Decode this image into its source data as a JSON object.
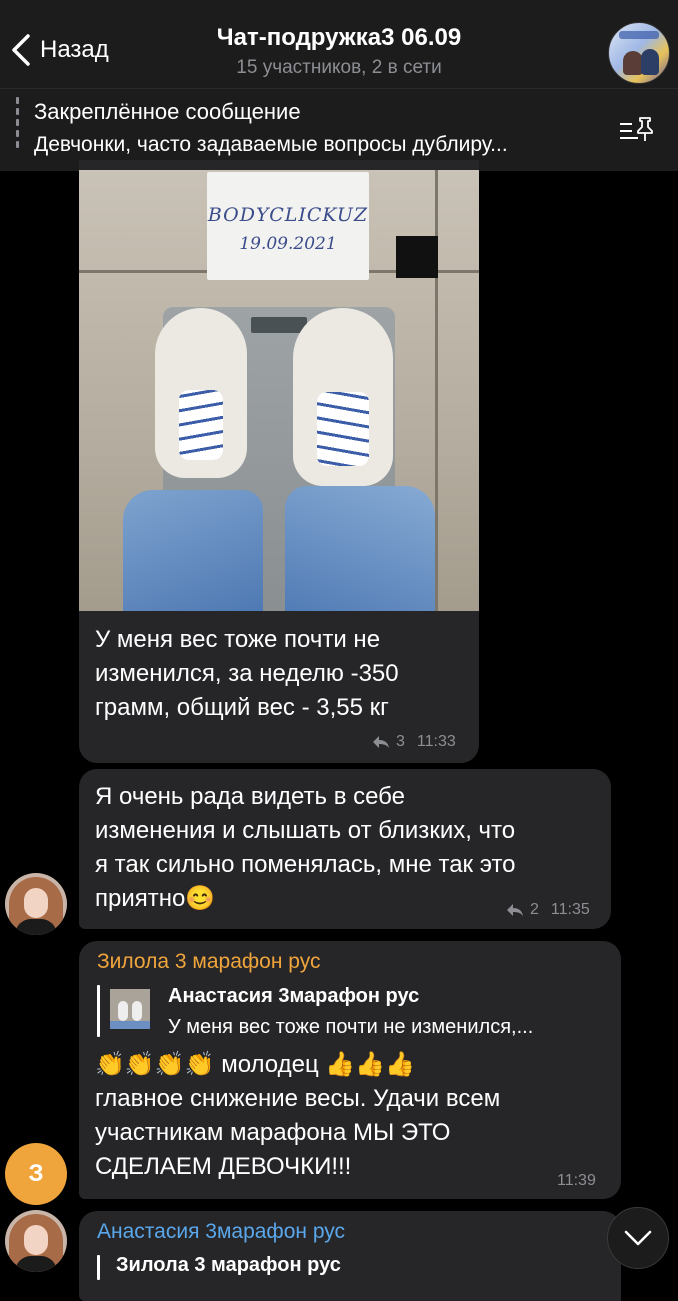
{
  "header": {
    "back_label": "Назад",
    "title": "Чат-подружка3 06.09",
    "subtitle": "15 участников, 2 в сети"
  },
  "pinned": {
    "title": "Закреплённое сообщение",
    "text": "Девчонки, часто задаваемые вопросы дублиру..."
  },
  "photo": {
    "note_line1": "BODYCLICKUZ",
    "note_line2": "19.09.2021"
  },
  "messages": [
    {
      "text_lines": [
        "У меня вес тоже почти не",
        "изменился, за неделю -350",
        "грамм, общий вес - 3,55 кг"
      ],
      "replies": "3",
      "time": "11:33"
    },
    {
      "text_lines": [
        "Я очень рада видеть в себе",
        "изменения и слышать от близких, что",
        "я так сильно поменялась, мне так это",
        "приятно"
      ],
      "emoji": "😊",
      "replies": "2",
      "time": "11:35"
    },
    {
      "sender": "Зилола 3 марафон рус",
      "reply_sender": "Анастасия 3марафон рус",
      "reply_text": "У меня вес тоже почти не изменился,...",
      "emoji_clap": "👏👏👏👏",
      "text_first": "молодец",
      "emoji_thumbs": "👍👍👍",
      "text_lines": [
        "главное снижение весы. Удачи всем",
        "участникам марафона  МЫ ЭТО",
        "СДЕЛАЕМ ДЕВОЧКИ!!!"
      ],
      "time": "11:39",
      "avatar_letter": "З"
    },
    {
      "sender": "Анастасия 3марафон рус",
      "reply_sender": "Зилола 3 марафон рус"
    }
  ],
  "colors": {
    "background": "#000000",
    "bubble": "#262628",
    "sender_orange": "#f0a53c",
    "sender_blue": "#5aa7ec",
    "meta_gray": "#8d8e93"
  }
}
